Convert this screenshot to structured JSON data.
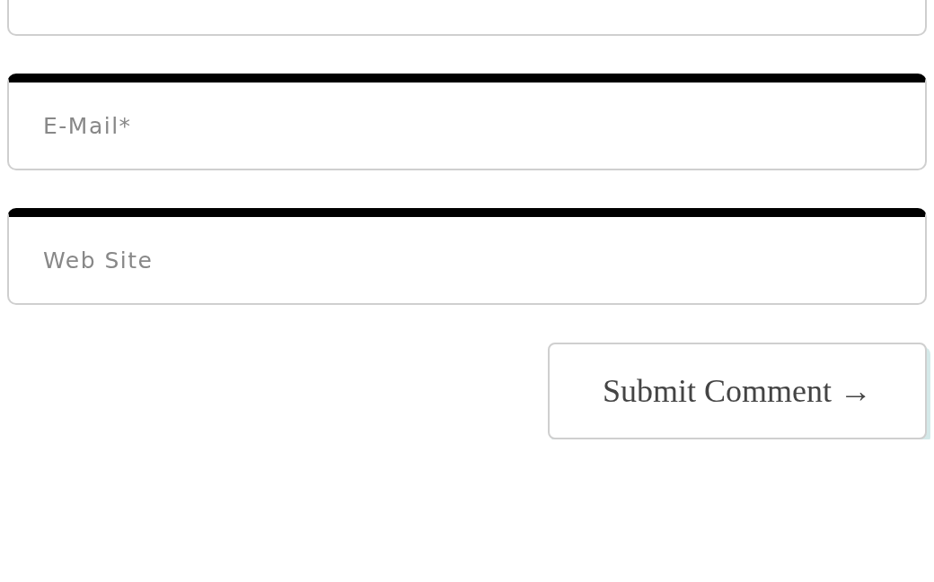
{
  "fields": [
    {
      "kind": "cut"
    },
    {
      "kind": "text",
      "placeholder": "E-Mail*"
    },
    {
      "kind": "text",
      "placeholder": "Web Site"
    }
  ],
  "submit_button": {
    "label": "Submit Comment →"
  }
}
